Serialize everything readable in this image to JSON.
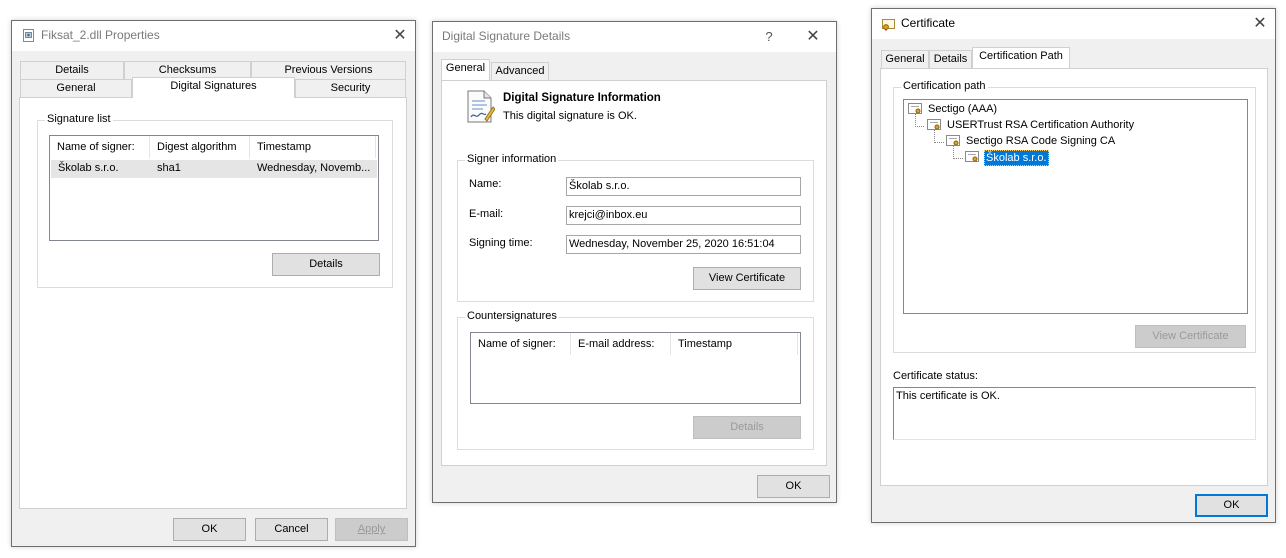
{
  "properties": {
    "title": "Fiksat_2.dll Properties",
    "close_glyph": "✕",
    "tabs_row1": [
      "Details",
      "Checksums",
      "Previous Versions"
    ],
    "tabs_row2": [
      "General",
      "Digital Signatures",
      "Security"
    ],
    "selected_tab": "Digital Signatures",
    "signature_list_label": "Signature list",
    "columns": [
      "Name of signer:",
      "Digest algorithm",
      "Timestamp"
    ],
    "rows": [
      {
        "signer": "Školab s.r.o.",
        "digest": "sha1",
        "timestamp": "Wednesday, Novemb..."
      }
    ],
    "details_button": "Details",
    "ok_button": "OK",
    "cancel_button": "Cancel",
    "apply_button": "Apply"
  },
  "signature_details": {
    "title": "Digital Signature Details",
    "help_glyph": "?",
    "close_glyph": "✕",
    "tabs": [
      "General",
      "Advanced"
    ],
    "selected_tab": "General",
    "info_heading": "Digital Signature Information",
    "info_text": "This digital signature is OK.",
    "signer_group_label": "Signer information",
    "name_label": "Name:",
    "name_value": "Školab s.r.o.",
    "email_label": "E-mail:",
    "email_value": "krejci@inbox.eu",
    "signing_time_label": "Signing time:",
    "signing_time_value": "Wednesday, November 25, 2020 16:51:04",
    "view_certificate_button": "View Certificate",
    "countersig_group_label": "Countersignatures",
    "countersig_columns": [
      "Name of signer:",
      "E-mail address:",
      "Timestamp"
    ],
    "details_button": "Details",
    "ok_button": "OK"
  },
  "certificate": {
    "title": "Certificate",
    "close_glyph": "✕",
    "tabs": [
      "General",
      "Details",
      "Certification Path"
    ],
    "selected_tab": "Certification Path",
    "path_group_label": "Certification path",
    "path": [
      "Sectigo (AAA)",
      "USERTrust RSA Certification Authority",
      "Sectigo RSA Code Signing CA",
      "Školab s.r.o."
    ],
    "selected_node": "Školab s.r.o.",
    "view_certificate_button": "View Certificate",
    "status_label": "Certificate status:",
    "status_text": "This certificate is OK.",
    "ok_button": "OK"
  },
  "colors": {
    "accent": "#0078d7",
    "selection_bg": "#0078d7",
    "row_highlight": "#e5e5e5"
  },
  "icons": [
    "dll-file-icon",
    "close-icon",
    "help-icon",
    "signature-document-icon",
    "certificate-icon"
  ]
}
